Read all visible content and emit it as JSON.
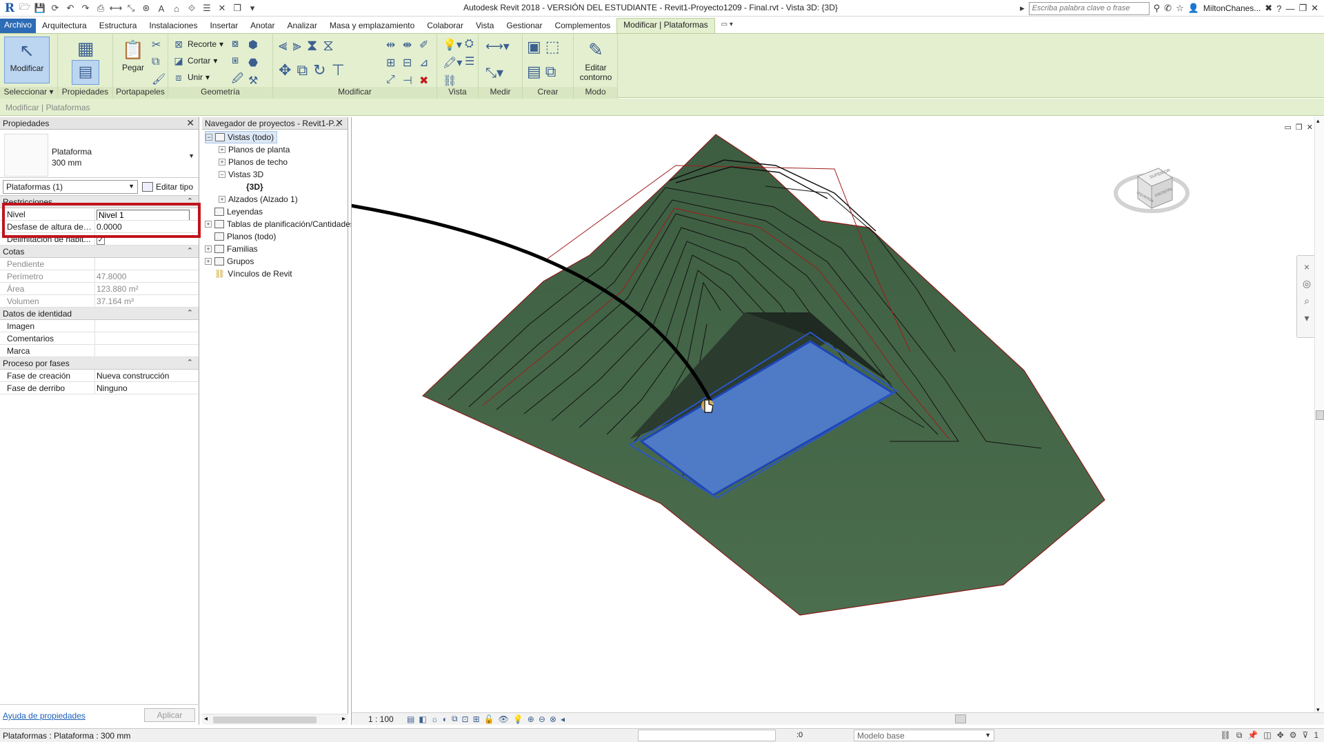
{
  "window": {
    "title": "Autodesk Revit 2018 - VERSIÓN DEL ESTUDIANTE -    Revit1-Proyecto1209 - Final.rvt - Vista 3D: {3D}",
    "search_placeholder": "Escriba palabra clave o frase",
    "user": "MiltonChanes...",
    "logo": "R"
  },
  "tabs": [
    "Archivo",
    "Arquitectura",
    "Estructura",
    "Instalaciones",
    "Insertar",
    "Anotar",
    "Analizar",
    "Masa y emplazamiento",
    "Colaborar",
    "Vista",
    "Gestionar",
    "Complementos",
    "Modificar | Plataformas"
  ],
  "ribbon": {
    "panels": {
      "seleccionar": "Seleccionar ▾",
      "propiedades": "Propiedades",
      "portapapeles": "Portapapeles",
      "geometria": "Geometría",
      "modificar": "Modificar",
      "vista": "Vista",
      "medir": "Medir",
      "crear": "Crear",
      "modo": "Modo"
    },
    "buttons": {
      "modificar": "Modificar",
      "pegar": "Pegar",
      "recorte": "Recorte",
      "cortar": "Cortar",
      "unir": "Unir",
      "editar_contorno_1": "Editar",
      "editar_contorno_2": "contorno"
    }
  },
  "options_bar": "Modificar | Plataformas",
  "properties": {
    "title": "Propiedades",
    "type_name_1": "Plataforma",
    "type_name_2": "300 mm",
    "filter": "Plataformas (1)",
    "edit_type": "Editar tipo",
    "groups": [
      {
        "name": "Restricciones",
        "rows": [
          {
            "key": "Nivel",
            "value": "Nivel 1",
            "edit": true
          },
          {
            "key": "Desfase de altura desd...",
            "value": "0.0000"
          },
          {
            "key": "Delimitación de habit...",
            "value": "✓",
            "check": true
          }
        ]
      },
      {
        "name": "Cotas",
        "rows": [
          {
            "key": "Pendiente",
            "value": "",
            "dim": true
          },
          {
            "key": "Perímetro",
            "value": "47.8000",
            "dim": true
          },
          {
            "key": "Área",
            "value": "123.880 m²",
            "dim": true
          },
          {
            "key": "Volumen",
            "value": "37.164 m³",
            "dim": true
          }
        ]
      },
      {
        "name": "Datos de identidad",
        "rows": [
          {
            "key": "Imagen",
            "value": ""
          },
          {
            "key": "Comentarios",
            "value": ""
          },
          {
            "key": "Marca",
            "value": ""
          }
        ]
      },
      {
        "name": "Proceso por fases",
        "rows": [
          {
            "key": "Fase de creación",
            "value": "Nueva construcción"
          },
          {
            "key": "Fase de derribo",
            "value": "Ninguno"
          }
        ]
      }
    ],
    "help_link": "Ayuda de propiedades",
    "apply": "Aplicar"
  },
  "browser": {
    "title": "Navegador de proyectos - Revit1-P...",
    "nodes": {
      "vistas": "Vistas (todo)",
      "planos_planta": "Planos de planta",
      "planos_techo": "Planos de techo",
      "vistas3d": "Vistas 3D",
      "v3d": "{3D}",
      "alzados": "Alzados (Alzado 1)",
      "leyendas": "Leyendas",
      "tablas": "Tablas de planificación/Cantidades",
      "planos": "Planos (todo)",
      "familias": "Familias",
      "grupos": "Grupos",
      "vinculos": "Vínculos de Revit"
    }
  },
  "viewcube": {
    "top": "SUPERIOR",
    "left": "IZQUIERDA",
    "front": "FRONTAL"
  },
  "view_controls": {
    "scale": "1 : 100"
  },
  "status": {
    "text": "Plataformas : Plataforma : 300 mm",
    "zero": ":0",
    "model": "Modelo base",
    "filter_count": "1"
  }
}
